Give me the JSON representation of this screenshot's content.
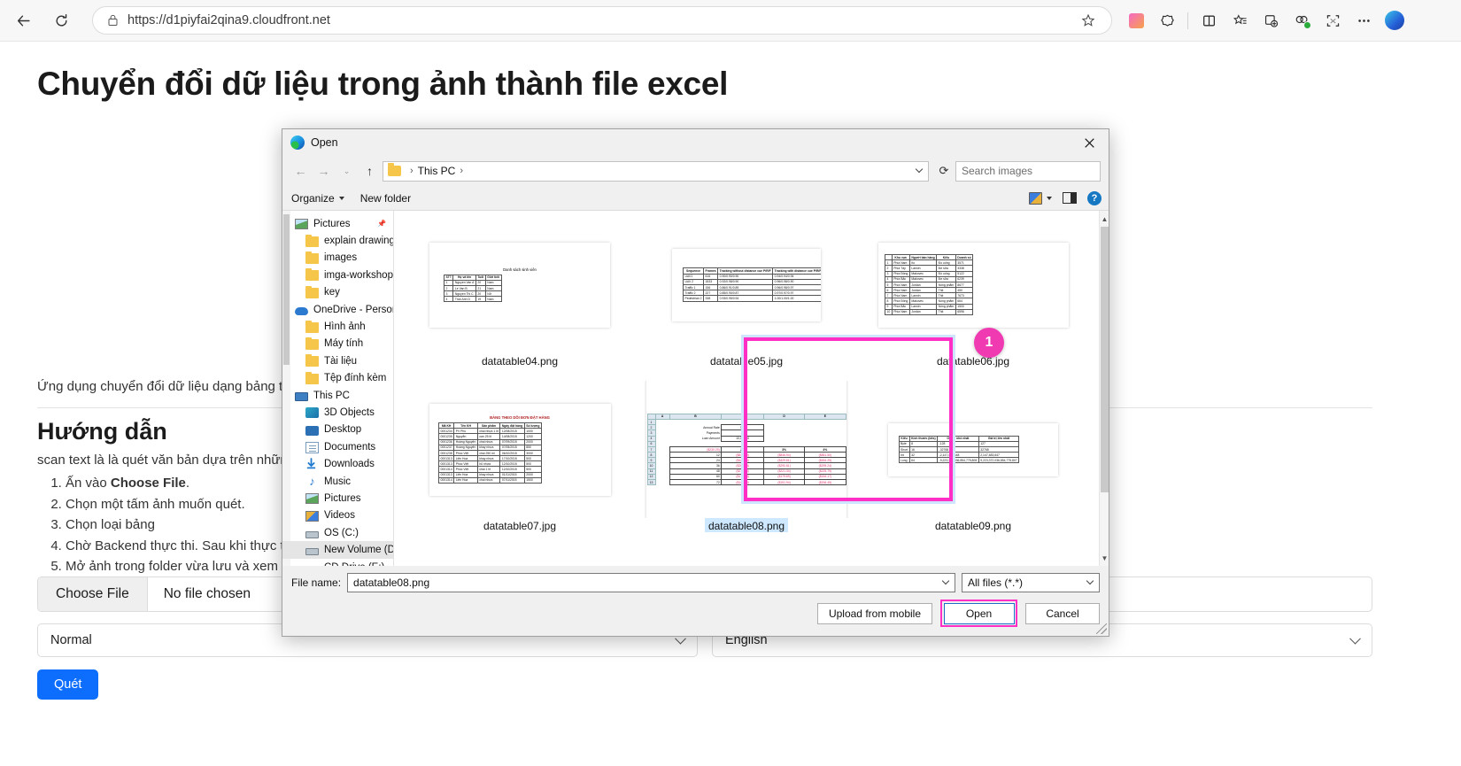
{
  "browser": {
    "url": "https://d1piyfai2qina9.cloudfront.net",
    "back_icon": "back-arrow-icon",
    "refresh_icon": "refresh-icon",
    "lock_icon": "lock-icon",
    "favorite_icon": "star-icon",
    "toolbar_icons": [
      "gradient-square-icon",
      "browser-essentials-icon",
      "split-screen-icon",
      "favorites-icon",
      "collections-icon",
      "profile-icon",
      "screenshot-icon",
      "more-icon",
      "copilot-icon"
    ]
  },
  "page": {
    "title": "Chuyển đổi dữ liệu trong ảnh thành file excel",
    "intro": "Ứng dụng chuyển đổi dữ liệu dạng bảng trong ảnh thành file excel",
    "section_title": "Hướng dẫn",
    "section_sub": "scan text là là quét văn bản dựa trên những điểm ảnh",
    "steps": [
      "Ấn vào Choose File.",
      "Chọn một tấm ảnh muốn quét.",
      "Chọn loại bảng",
      "Chờ Backend thực thi. Sau khi thực thi xong",
      "Mở ảnh trong folder vừa lưu và xem kết quả"
    ],
    "step1_prefix": "Ấn vào ",
    "step1_bold": "Choose File",
    "step1_suffix": ".",
    "choose_file_label": "Choose File",
    "no_file_label": "No file chosen",
    "table_type_value": "Normal",
    "language_value": "English",
    "scan_button": "Quét"
  },
  "dialog": {
    "title": "Open",
    "close_label": "✕",
    "breadcrumb_root": "This PC",
    "breadcrumb_sep": "›",
    "search_placeholder": "Search images",
    "organize_label": "Organize",
    "new_folder_label": "New folder",
    "help_label": "?",
    "sidebar": [
      {
        "label": "Pictures",
        "icon": "pictures-icon",
        "indent": false,
        "pinned": true
      },
      {
        "label": "explain drawing",
        "icon": "folder-icon",
        "indent": true
      },
      {
        "label": "images",
        "icon": "folder-icon",
        "indent": true
      },
      {
        "label": "imga-workshop",
        "icon": "folder-icon",
        "indent": true
      },
      {
        "label": "key",
        "icon": "folder-icon",
        "indent": true
      },
      {
        "label": "OneDrive - Personal",
        "icon": "cloud-icon",
        "indent": false
      },
      {
        "label": "Hình ảnh",
        "icon": "folder-icon",
        "indent": true
      },
      {
        "label": "Máy tính",
        "icon": "folder-icon",
        "indent": true
      },
      {
        "label": "Tài liệu",
        "icon": "folder-icon",
        "indent": true
      },
      {
        "label": "Tệp đính kèm",
        "icon": "folder-icon",
        "indent": true
      },
      {
        "label": "This PC",
        "icon": "pc-icon",
        "indent": false
      },
      {
        "label": "3D Objects",
        "icon": "3d-objects-icon",
        "indent": true
      },
      {
        "label": "Desktop",
        "icon": "desktop-icon",
        "indent": true
      },
      {
        "label": "Documents",
        "icon": "documents-icon",
        "indent": true
      },
      {
        "label": "Downloads",
        "icon": "downloads-icon",
        "indent": true
      },
      {
        "label": "Music",
        "icon": "music-icon",
        "indent": true
      },
      {
        "label": "Pictures",
        "icon": "pictures-icon",
        "indent": true
      },
      {
        "label": "Videos",
        "icon": "videos-icon",
        "indent": true
      },
      {
        "label": "OS (C:)",
        "icon": "drive-icon",
        "indent": true
      },
      {
        "label": "New Volume (D:)",
        "icon": "drive-icon",
        "indent": true,
        "selected": true
      },
      {
        "label": "CD Drive (E:)",
        "icon": "cd-drive-icon",
        "indent": true
      }
    ],
    "files": [
      {
        "name": "datatable04.png",
        "kind": "student-list"
      },
      {
        "name": "datatable05.jpg",
        "kind": "tracking"
      },
      {
        "name": "datatable06.jpg",
        "kind": "sales"
      },
      {
        "name": "datatable07.jpg",
        "kind": "order"
      },
      {
        "name": "datatable08.png",
        "kind": "loan",
        "selected": true
      },
      {
        "name": "datatable09.png",
        "kind": "size"
      },
      {
        "name": "",
        "kind": "size"
      },
      {
        "name": "",
        "kind": "size"
      },
      {
        "name": "",
        "kind": "size"
      }
    ],
    "annotation_badge": "1",
    "file_name_label": "File name:",
    "file_name_value": "datatable08.png",
    "filter_value": "All files (*.*)",
    "upload_mobile_label": "Upload from mobile",
    "open_label": "Open",
    "cancel_label": "Cancel"
  },
  "thumbnails": {
    "student_list": {
      "title": "Danh sách sinh viên",
      "headers": [
        "STT",
        "Họ và tên",
        "Tuổi",
        "Giới tính"
      ],
      "rows": [
        [
          "1",
          "Nguyen Van A",
          "20",
          "Nam"
        ],
        [
          "2",
          "Le Van B",
          "21",
          "Nam"
        ],
        [
          "3",
          "Nguyen Thi C",
          "20",
          "Nữ"
        ],
        [
          "4",
          "Tran Anh D",
          "19",
          "Nam"
        ]
      ]
    },
    "tracking": {
      "headers": [
        "Sequence",
        "Frames",
        "Tracking without distance cue P/R/F",
        "Tracking with distance cue P/R/F"
      ],
      "rows": [
        [
          "UAV1",
          "616",
          "0.90/0.90/0.90",
          "0.94/0.94/0.94"
        ],
        [
          "UAV 2",
          "1833",
          "0.92/0.98/0.90",
          "0.96/0.98/0.90"
        ],
        [
          "Traffic 1",
          "156",
          "0.86/0.91/0.89",
          "0.96/0.98/0.97"
        ],
        [
          "Traffic 2",
          "227",
          "0.85/0.90/0.87",
          "0.97/0.97/0.97"
        ],
        [
          "Pedestrian 2",
          "338",
          "0.93/0.95/0.94",
          "1.00/1.00/1.00"
        ]
      ]
    },
    "sales": {
      "headers": [
        "",
        "Khu vực",
        "Người bán hàng",
        "Kiểu",
        "Doanh số"
      ],
      "rows": [
        [
          "1",
          "Phía Nam",
          "Ito",
          "Đồ uống",
          "3571"
        ],
        [
          "2",
          "Phía Tây",
          "Lannin",
          "Bơ sữa",
          "3338"
        ],
        [
          "3",
          "Phía Đông",
          "Makovec",
          "Đồ uống",
          "5122"
        ],
        [
          "4",
          "Phía Bắc",
          "Makovec",
          "Bơ sữa",
          "6239"
        ],
        [
          "5",
          "Phía Nam",
          "Jordan",
          "Nông phẩm",
          "8677"
        ],
        [
          "6",
          "Phía Nam",
          "Jordan",
          "Thịt",
          "450"
        ],
        [
          "7",
          "Phía Nam",
          "Lannin",
          "Thịt",
          "7673"
        ],
        [
          "8",
          "Phía Đông",
          "Makovec",
          "Nông phẩm",
          "664"
        ],
        [
          "9",
          "Phía Bắc",
          "Lannin",
          "Nông phẩm",
          "1500"
        ],
        [
          "10",
          "Phía Nam",
          "Jordan",
          "Thịt",
          "6596"
        ]
      ]
    },
    "order": {
      "title": "BẢNG THEO DÕI ĐƠN ĐẶT HÀNG",
      "headers": [
        "Mã KH",
        "Tên KH",
        "Sản phẩm",
        "Ngày đặt hàng",
        "Số lượng"
      ],
      "rows": [
        [
          "0001234",
          "PV Phú",
          "chai nhựa 1 lít",
          "12/08/2015",
          "1000"
        ],
        [
          "0001235",
          "Nguyễn",
          "can 25 lít",
          "14/08/2015",
          "1200"
        ],
        [
          "0001236",
          "Hoàng Nguyên",
          "chai nhựa",
          "07/09/2015",
          "2000"
        ],
        [
          "0001237",
          "Hoàng Nguyên",
          "khay nhựa",
          "07/05/2015",
          "850"
        ],
        [
          "0001238",
          "Phúc Việt",
          "chai 250 ml",
          "06/10/2015",
          "3000"
        ],
        [
          "0001313",
          "Liên Hoa",
          "khay nhựa",
          "17/10/2015",
          "500"
        ],
        [
          "0001313",
          "Phúc Việt",
          "hũ nhựa",
          "12/10/2015",
          "500"
        ],
        [
          "0001314",
          "Phúc Việt",
          "chai 1 lít",
          "12/10/2015",
          "500"
        ],
        [
          "0001313",
          "Liên Hoa",
          "khay nhựa",
          "01/11/2015",
          "2000"
        ],
        [
          "0001314",
          "Liên Hoa",
          "chai nhựa",
          "07/11/2015",
          "1500"
        ]
      ]
    },
    "size": {
      "headers": [
        "Kiểu",
        "Kích thước (bits)",
        "Giá trị nhỏ nhất",
        "Giá trị lớn nhất"
      ],
      "rows": [
        [
          "Byte",
          "8",
          "-128",
          "127"
        ],
        [
          "Short",
          "16",
          "-32768",
          "32768"
        ],
        [
          "Int",
          "32",
          "-2,147,483,648",
          "2,147,483,647"
        ],
        [
          "Long",
          "64",
          "-9,223,372,036,854,775,808",
          "9,223,372,036,854,775,807"
        ]
      ]
    },
    "loan": {
      "col_headers": [
        "",
        "A",
        "B",
        "C",
        "D",
        "E"
      ],
      "row_numbers": [
        "1",
        "2",
        "3",
        "4",
        "6",
        "7",
        "8",
        "9",
        "10",
        "11",
        "12",
        "13"
      ],
      "params": [
        {
          "label": "Annual Rate",
          "value": "5%"
        },
        {
          "label": "Payments",
          "value": "48"
        },
        {
          "label": "Loan Amount",
          "value": "10,000.00"
        }
      ],
      "corner": "($230.29)",
      "rate_headers": [
        "2%",
        "3%",
        "4%"
      ],
      "terms": [
        "12",
        "24",
        "36",
        "48",
        "60",
        "72"
      ],
      "values": [
        [
          "($842.39)",
          "($846.94)",
          "($851.50)"
        ],
        [
          "($425.40)",
          "($429.81)",
          "($454.25)"
        ],
        [
          "($286.43)",
          "($290.81)",
          "($295.24)"
        ],
        [
          "($216.95)",
          "($221.34)",
          "($225.79)"
        ],
        [
          "($175.28)",
          "($179.69)",
          "($184.17)"
        ],
        [
          "($147.50)",
          "($151.94)",
          "($156.45)"
        ]
      ]
    }
  },
  "colors": {
    "accent_blue": "#0d6efd",
    "annotation_pink": "#ff2ec4",
    "badge_pink": "#ef3ab2",
    "selection_blue": "#cde8ff"
  }
}
